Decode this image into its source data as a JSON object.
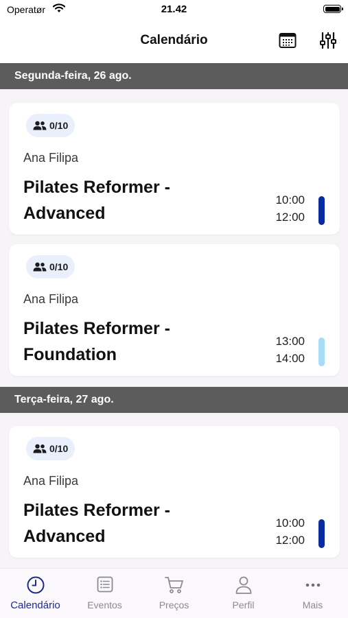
{
  "status_bar": {
    "carrier": "Operatør",
    "time": "21.42"
  },
  "header": {
    "title": "Calendário"
  },
  "colors": {
    "accent": "#1c2a8c",
    "advanced_level": "#0a2aa0",
    "foundation_level": "#a8dcf6",
    "date_bar": "#5c5c5c"
  },
  "days": [
    {
      "label": "Segunda-feira, 26 ago.",
      "classes": [
        {
          "capacity": "0/10",
          "instructor": "Ana Filipa",
          "title_line1": "Pilates Reformer -",
          "title_line2": "Advanced",
          "start": "10:00",
          "end": "12:00",
          "level_color": "#0a2aa0"
        },
        {
          "capacity": "0/10",
          "instructor": "Ana Filipa",
          "title_line1": "Pilates Reformer -",
          "title_line2": "Foundation",
          "start": "13:00",
          "end": "14:00",
          "level_color": "#a8dcf6"
        }
      ]
    },
    {
      "label": "Terça-feira, 27 ago.",
      "classes": [
        {
          "capacity": "0/10",
          "instructor": "Ana Filipa",
          "title_line1": "Pilates Reformer -",
          "title_line2": "Advanced",
          "start": "10:00",
          "end": "12:00",
          "level_color": "#0a2aa0"
        }
      ]
    }
  ],
  "tabs": [
    {
      "label": "Calendário",
      "icon": "clock-icon",
      "active": true
    },
    {
      "label": "Eventos",
      "icon": "list-icon",
      "active": false
    },
    {
      "label": "Preços",
      "icon": "cart-icon",
      "active": false
    },
    {
      "label": "Perfil",
      "icon": "person-icon",
      "active": false
    },
    {
      "label": "Mais",
      "icon": "more-dots-icon",
      "active": false
    }
  ]
}
